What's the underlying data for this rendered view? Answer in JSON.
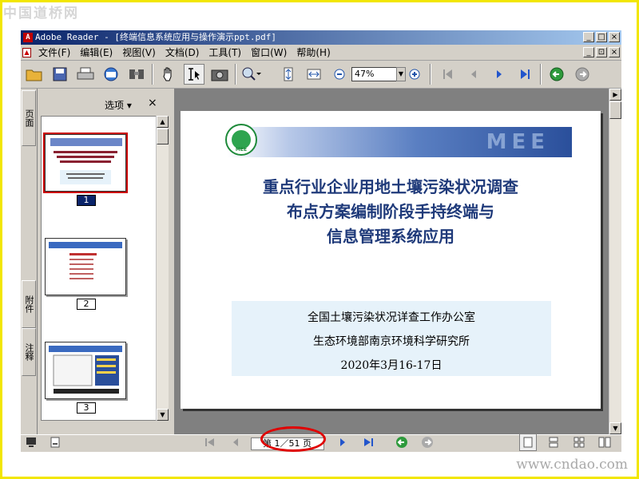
{
  "watermarks": {
    "top": "中国道桥网",
    "bottom": "www.cndao.com"
  },
  "window": {
    "title": "Adobe Reader - [终端信息系统应用与操作演示ppt.pdf]",
    "controls": [
      "_",
      "□",
      "×"
    ],
    "doc_controls": [
      "_",
      "⊡",
      "×"
    ]
  },
  "menu": {
    "items": [
      "文件(F)",
      "编辑(E)",
      "视图(V)",
      "文档(D)",
      "工具(T)",
      "窗口(W)",
      "帮助(H)"
    ]
  },
  "toolbar": {
    "zoom_value": "47%",
    "icons": [
      "open-icon",
      "save-icon",
      "print-icon",
      "email-icon",
      "search-icon",
      "hand-icon",
      "select-text-icon",
      "snapshot-icon",
      "zoom-icon",
      "fit-height-icon",
      "fit-width-icon",
      "zoom-out-icon",
      "zoom-in-icon",
      "first-page-icon",
      "prev-page-icon",
      "next-page-icon",
      "last-page-icon",
      "back-icon",
      "forward-icon"
    ]
  },
  "nav_tabs": [
    "页面",
    "附件",
    "注释"
  ],
  "nav_panel": {
    "options_label": "选项 ▾",
    "close_label": "×",
    "thumbnails": [
      {
        "label": "1",
        "selected": true
      },
      {
        "label": "2",
        "selected": false
      },
      {
        "label": "3",
        "selected": false
      }
    ]
  },
  "slide": {
    "banner_text": "MEE",
    "logo_text": "MEE",
    "title_lines": [
      "重点行业企业用地土壤污染状况调查",
      "布点方案编制阶段手持终端与",
      "信息管理系统应用"
    ],
    "info_lines": [
      "全国土壤污染状况详查工作办公室",
      "生态环境部南京环境科学研究所",
      "2020年3月16-17日"
    ]
  },
  "statusbar": {
    "page_indicator": "第 1／51 页"
  },
  "colors": {
    "frame_border": "#f2e600",
    "titlebar_start": "#0a246a",
    "titlebar_end": "#a6caf0",
    "slide_title": "#1f3a7a",
    "annotation_circle": "#e00000"
  }
}
